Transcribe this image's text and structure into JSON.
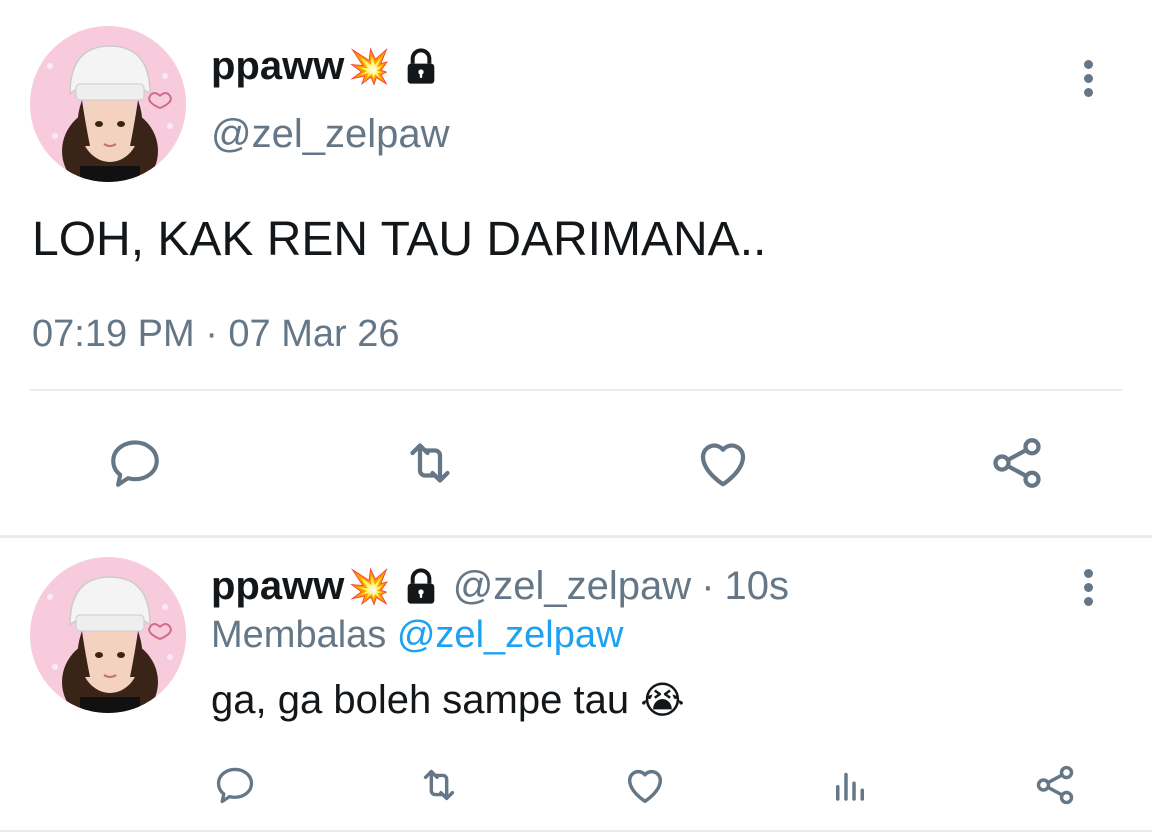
{
  "main_tweet": {
    "display_name": "ppaww",
    "name_emoji": "💥",
    "handle": "@zel_zelpaw",
    "text": "LOH, KAK REN TAU DARIMANA..",
    "timestamp": "07:19 PM · 07 Mar 26",
    "actions": [
      "reply-icon",
      "retweet-icon",
      "like-icon",
      "share-icon"
    ]
  },
  "reply_tweet": {
    "display_name": "ppaww",
    "name_emoji": "💥",
    "handle": "@zel_zelpaw",
    "separator": "·",
    "time": "10s",
    "replying_prefix": "Membalas",
    "replying_to": "@zel_zelpaw",
    "text": "ga, ga boleh sampe tau",
    "text_emoji": "😭",
    "actions": [
      "reply-icon",
      "retweet-icon",
      "like-icon",
      "analytics-icon",
      "share-icon"
    ]
  },
  "colors": {
    "text": "#14171a",
    "secondary": "#657786",
    "link": "#1da1f2",
    "divider": "#e6ecf0"
  }
}
